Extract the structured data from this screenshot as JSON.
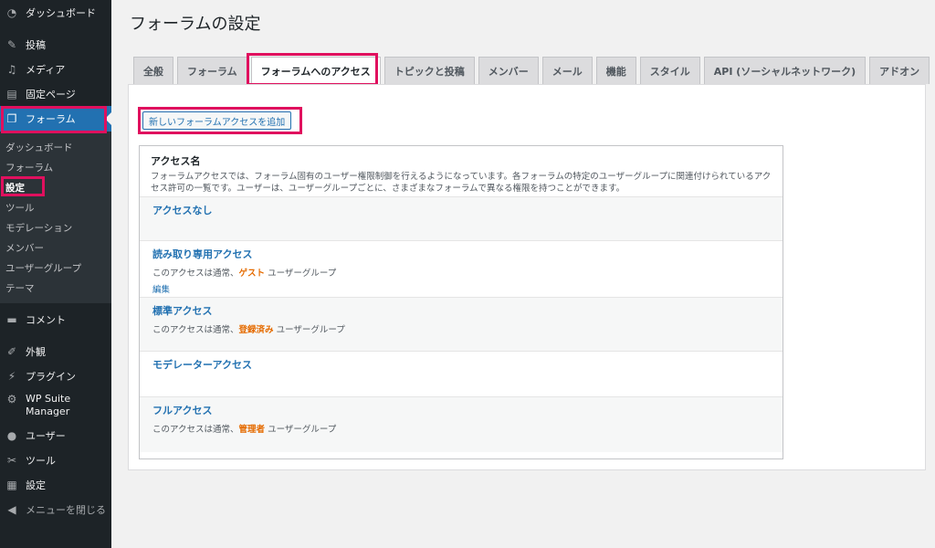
{
  "sidebar": {
    "top_items": [
      {
        "label": "ダッシュボード",
        "icon": "dashboard-icon"
      },
      {
        "label": "投稿",
        "icon": "pin-icon"
      },
      {
        "label": "メディア",
        "icon": "media-icon"
      },
      {
        "label": "固定ページ",
        "icon": "page-icon"
      },
      {
        "label": "フォーラム",
        "icon": "forum-icon"
      }
    ],
    "submenu": [
      "ダッシュボード",
      "フォーラム",
      "設定",
      "ツール",
      "モデレーション",
      "メンバー",
      "ユーザーグループ",
      "テーマ"
    ],
    "bottom_items": [
      {
        "label": "コメント",
        "icon": "comment-icon"
      },
      {
        "label": "外観",
        "icon": "brush-icon"
      },
      {
        "label": "プラグイン",
        "icon": "plugin-icon"
      },
      {
        "label": "WP Suite Manager",
        "icon": "gear-icon"
      },
      {
        "label": "ユーザー",
        "icon": "user-icon"
      },
      {
        "label": "ツール",
        "icon": "wrench-icon"
      },
      {
        "label": "設定",
        "icon": "settings-icon"
      },
      {
        "label": "メニューを閉じる",
        "icon": "collapse-icon"
      }
    ]
  },
  "page": {
    "title": "フォーラムの設定"
  },
  "tabs": [
    "全般",
    "フォーラム",
    "フォーラムへのアクセス",
    "トピックと投稿",
    "メンバー",
    "メール",
    "機能",
    "スタイル",
    "API (ソーシャルネットワーク)",
    "アドオン"
  ],
  "add_button": "新しいフォーラムアクセスを追加",
  "table": {
    "header_title": "アクセス名",
    "header_desc": "フォーラムアクセスでは、フォーラム固有のユーザー権限制御を行えるようになっています。各フォーラムの特定のユーザーグループに関連付けられているアクセス許可の一覧です。ユーザーは、ユーザーグループごとに、さまざまなフォーラムで異なる権限を持つことができます。",
    "rows": [
      {
        "title": "アクセスなし"
      },
      {
        "title": "読み取り専用アクセス",
        "desc_prefix": "このアクセスは通常、",
        "group": "ゲスト",
        "desc_suffix": " ユーザーグループ",
        "edit": "編集"
      },
      {
        "title": "標準アクセス",
        "desc_prefix": "このアクセスは通常、",
        "group": "登録済み",
        "desc_suffix": " ユーザーグループ"
      },
      {
        "title": "モデレーターアクセス"
      },
      {
        "title": "フルアクセス",
        "desc_prefix": "このアクセスは通常、",
        "group": "管理者",
        "desc_suffix": " ユーザーグループ"
      }
    ]
  },
  "colors": {
    "sidebar_bg": "#1d2327",
    "accent": "#2271b1",
    "highlight": "#e0105e",
    "group_label": "#e56b00"
  }
}
